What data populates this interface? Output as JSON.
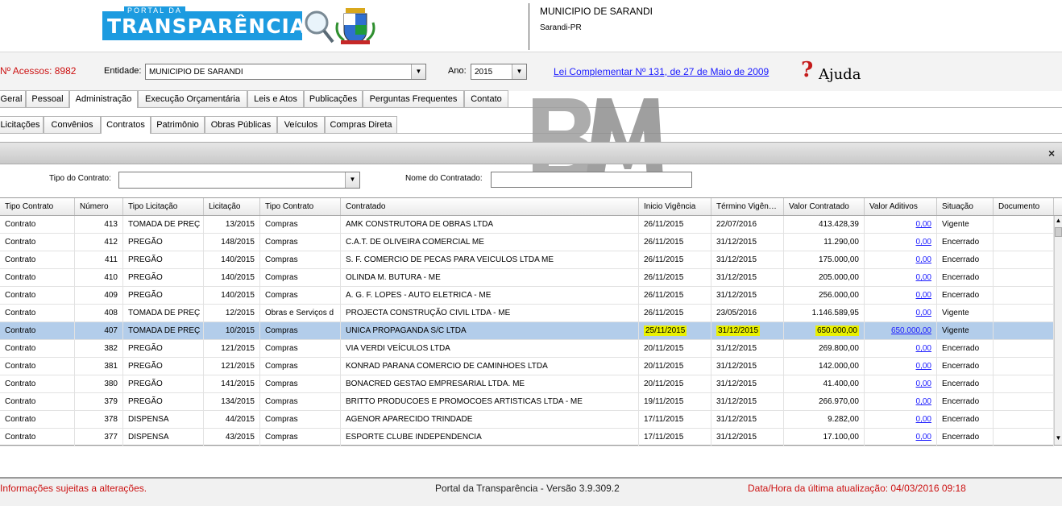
{
  "header": {
    "logo_small": "PORTAL DA",
    "logo_title": "TRANSPARÊNCIA",
    "municipio": "MUNICIPIO DE SARANDI",
    "cidade": "Sarandi-PR"
  },
  "filters": {
    "acessos": "Nº Acessos: 8982",
    "entidade_label": "Entidade:",
    "entidade_value": "MUNICIPIO DE SARANDI",
    "ano_label": "Ano:",
    "ano_value": "2015",
    "lei_link": "Lei Complementar Nº 131, de 27 de Maio de 2009",
    "ajuda": "Ajuda"
  },
  "main_tabs": [
    "Geral",
    "Pessoal",
    "Administração",
    "Execução Orçamentária",
    "Leis e Atos",
    "Publicações",
    "Perguntas Frequentes",
    "Contato"
  ],
  "sub_tabs": [
    "Licitações",
    "Convênios",
    "Contratos",
    "Patrimônio",
    "Obras Públicas",
    "Veículos",
    "Compras Direta"
  ],
  "panel": {
    "close": "×",
    "tipo_contrato_label": "Tipo do Contrato:",
    "tipo_contrato_value": "",
    "nome_contratado_label": "Nome do Contratado:",
    "nome_contratado_value": ""
  },
  "grid": {
    "columns": [
      "Tipo Contrato",
      "Número",
      "Tipo Licitação",
      "Licitação",
      "Tipo Contrato",
      "Contratado",
      "Inicio Vigência",
      "Término Vigên…",
      "Valor Contratado",
      "Valor Aditivos",
      "Situação",
      "Documento"
    ],
    "rows": [
      [
        "Contrato",
        "413",
        "TOMADA DE PREÇ",
        "13/2015",
        "Compras",
        "AMK CONSTRUTORA DE OBRAS LTDA",
        "26/11/2015",
        "22/07/2016",
        "413.428,39",
        "0,00",
        "Vigente",
        ""
      ],
      [
        "Contrato",
        "412",
        "PREGÃO",
        "148/2015",
        "Compras",
        "C.A.T. DE OLIVEIRA COMERCIAL ME",
        "26/11/2015",
        "31/12/2015",
        "11.290,00",
        "0,00",
        "Encerrado",
        ""
      ],
      [
        "Contrato",
        "411",
        "PREGÃO",
        "140/2015",
        "Compras",
        "S. F. COMERCIO DE PECAS PARA VEICULOS LTDA ME",
        "26/11/2015",
        "31/12/2015",
        "175.000,00",
        "0,00",
        "Encerrado",
        ""
      ],
      [
        "Contrato",
        "410",
        "PREGÃO",
        "140/2015",
        "Compras",
        "OLINDA M. BUTURA - ME",
        "26/11/2015",
        "31/12/2015",
        "205.000,00",
        "0,00",
        "Encerrado",
        ""
      ],
      [
        "Contrato",
        "409",
        "PREGÃO",
        "140/2015",
        "Compras",
        "A. G. F. LOPES -  AUTO ELETRICA - ME",
        "26/11/2015",
        "31/12/2015",
        "256.000,00",
        "0,00",
        "Encerrado",
        ""
      ],
      [
        "Contrato",
        "408",
        "TOMADA DE PREÇ",
        "12/2015",
        "Obras e Serviços d",
        "PROJECTA CONSTRUÇÃO CIVIL LTDA - ME",
        "26/11/2015",
        "23/05/2016",
        "1.146.589,95",
        "0,00",
        "Vigente",
        ""
      ],
      [
        "Contrato",
        "407",
        "TOMADA DE PREÇ",
        "10/2015",
        "Compras",
        "UNICA PROPAGANDA S/C LTDA",
        "25/11/2015",
        "31/12/2015",
        "650.000,00",
        "650.000,00",
        "Vigente",
        ""
      ],
      [
        "Contrato",
        "382",
        "PREGÃO",
        "121/2015",
        "Compras",
        "VIA VERDI VEÍCULOS LTDA",
        "20/11/2015",
        "31/12/2015",
        "269.800,00",
        "0,00",
        "Encerrado",
        ""
      ],
      [
        "Contrato",
        "381",
        "PREGÃO",
        "121/2015",
        "Compras",
        "KONRAD PARANA COMERCIO DE CAMINHOES LTDA",
        "20/11/2015",
        "31/12/2015",
        "142.000,00",
        "0,00",
        "Encerrado",
        ""
      ],
      [
        "Contrato",
        "380",
        "PREGÃO",
        "141/2015",
        "Compras",
        "BONACRED GESTAO EMPRESARIAL LTDA. ME",
        "20/11/2015",
        "31/12/2015",
        "41.400,00",
        "0,00",
        "Encerrado",
        ""
      ],
      [
        "Contrato",
        "379",
        "PREGÃO",
        "134/2015",
        "Compras",
        "BRITTO PRODUCOES E PROMOCOES ARTISTICAS LTDA - ME",
        "19/11/2015",
        "31/12/2015",
        "266.970,00",
        "0,00",
        "Encerrado",
        ""
      ],
      [
        "Contrato",
        "378",
        "DISPENSA",
        "44/2015",
        "Compras",
        "AGENOR APARECIDO TRINDADE",
        "17/11/2015",
        "31/12/2015",
        "9.282,00",
        "0,00",
        "Encerrado",
        ""
      ],
      [
        "Contrato",
        "377",
        "DISPENSA",
        "43/2015",
        "Compras",
        "ESPORTE CLUBE INDEPENDENCIA",
        "17/11/2015",
        "31/12/2015",
        "17.100,00",
        "0,00",
        "Encerrado",
        ""
      ]
    ]
  },
  "footer": {
    "left": "Informações sujeitas a alterações.",
    "center": "Portal da Transparência - Versão 3.9.309.2",
    "right": "Data/Hora da última atualização: 04/03/2016 09:18"
  },
  "colors": {
    "accent_blue": "#1c9be0",
    "selected_row": "#b3cdea",
    "highlight": "#e9f000",
    "alert_red": "#cc1111",
    "link": "#1a1aff"
  },
  "icons": [
    "magnifier-icon",
    "coat-of-arms-icon",
    "help-question-icon",
    "chevron-down-icon",
    "close-icon",
    "scroll-up-icon",
    "scroll-down-icon"
  ]
}
